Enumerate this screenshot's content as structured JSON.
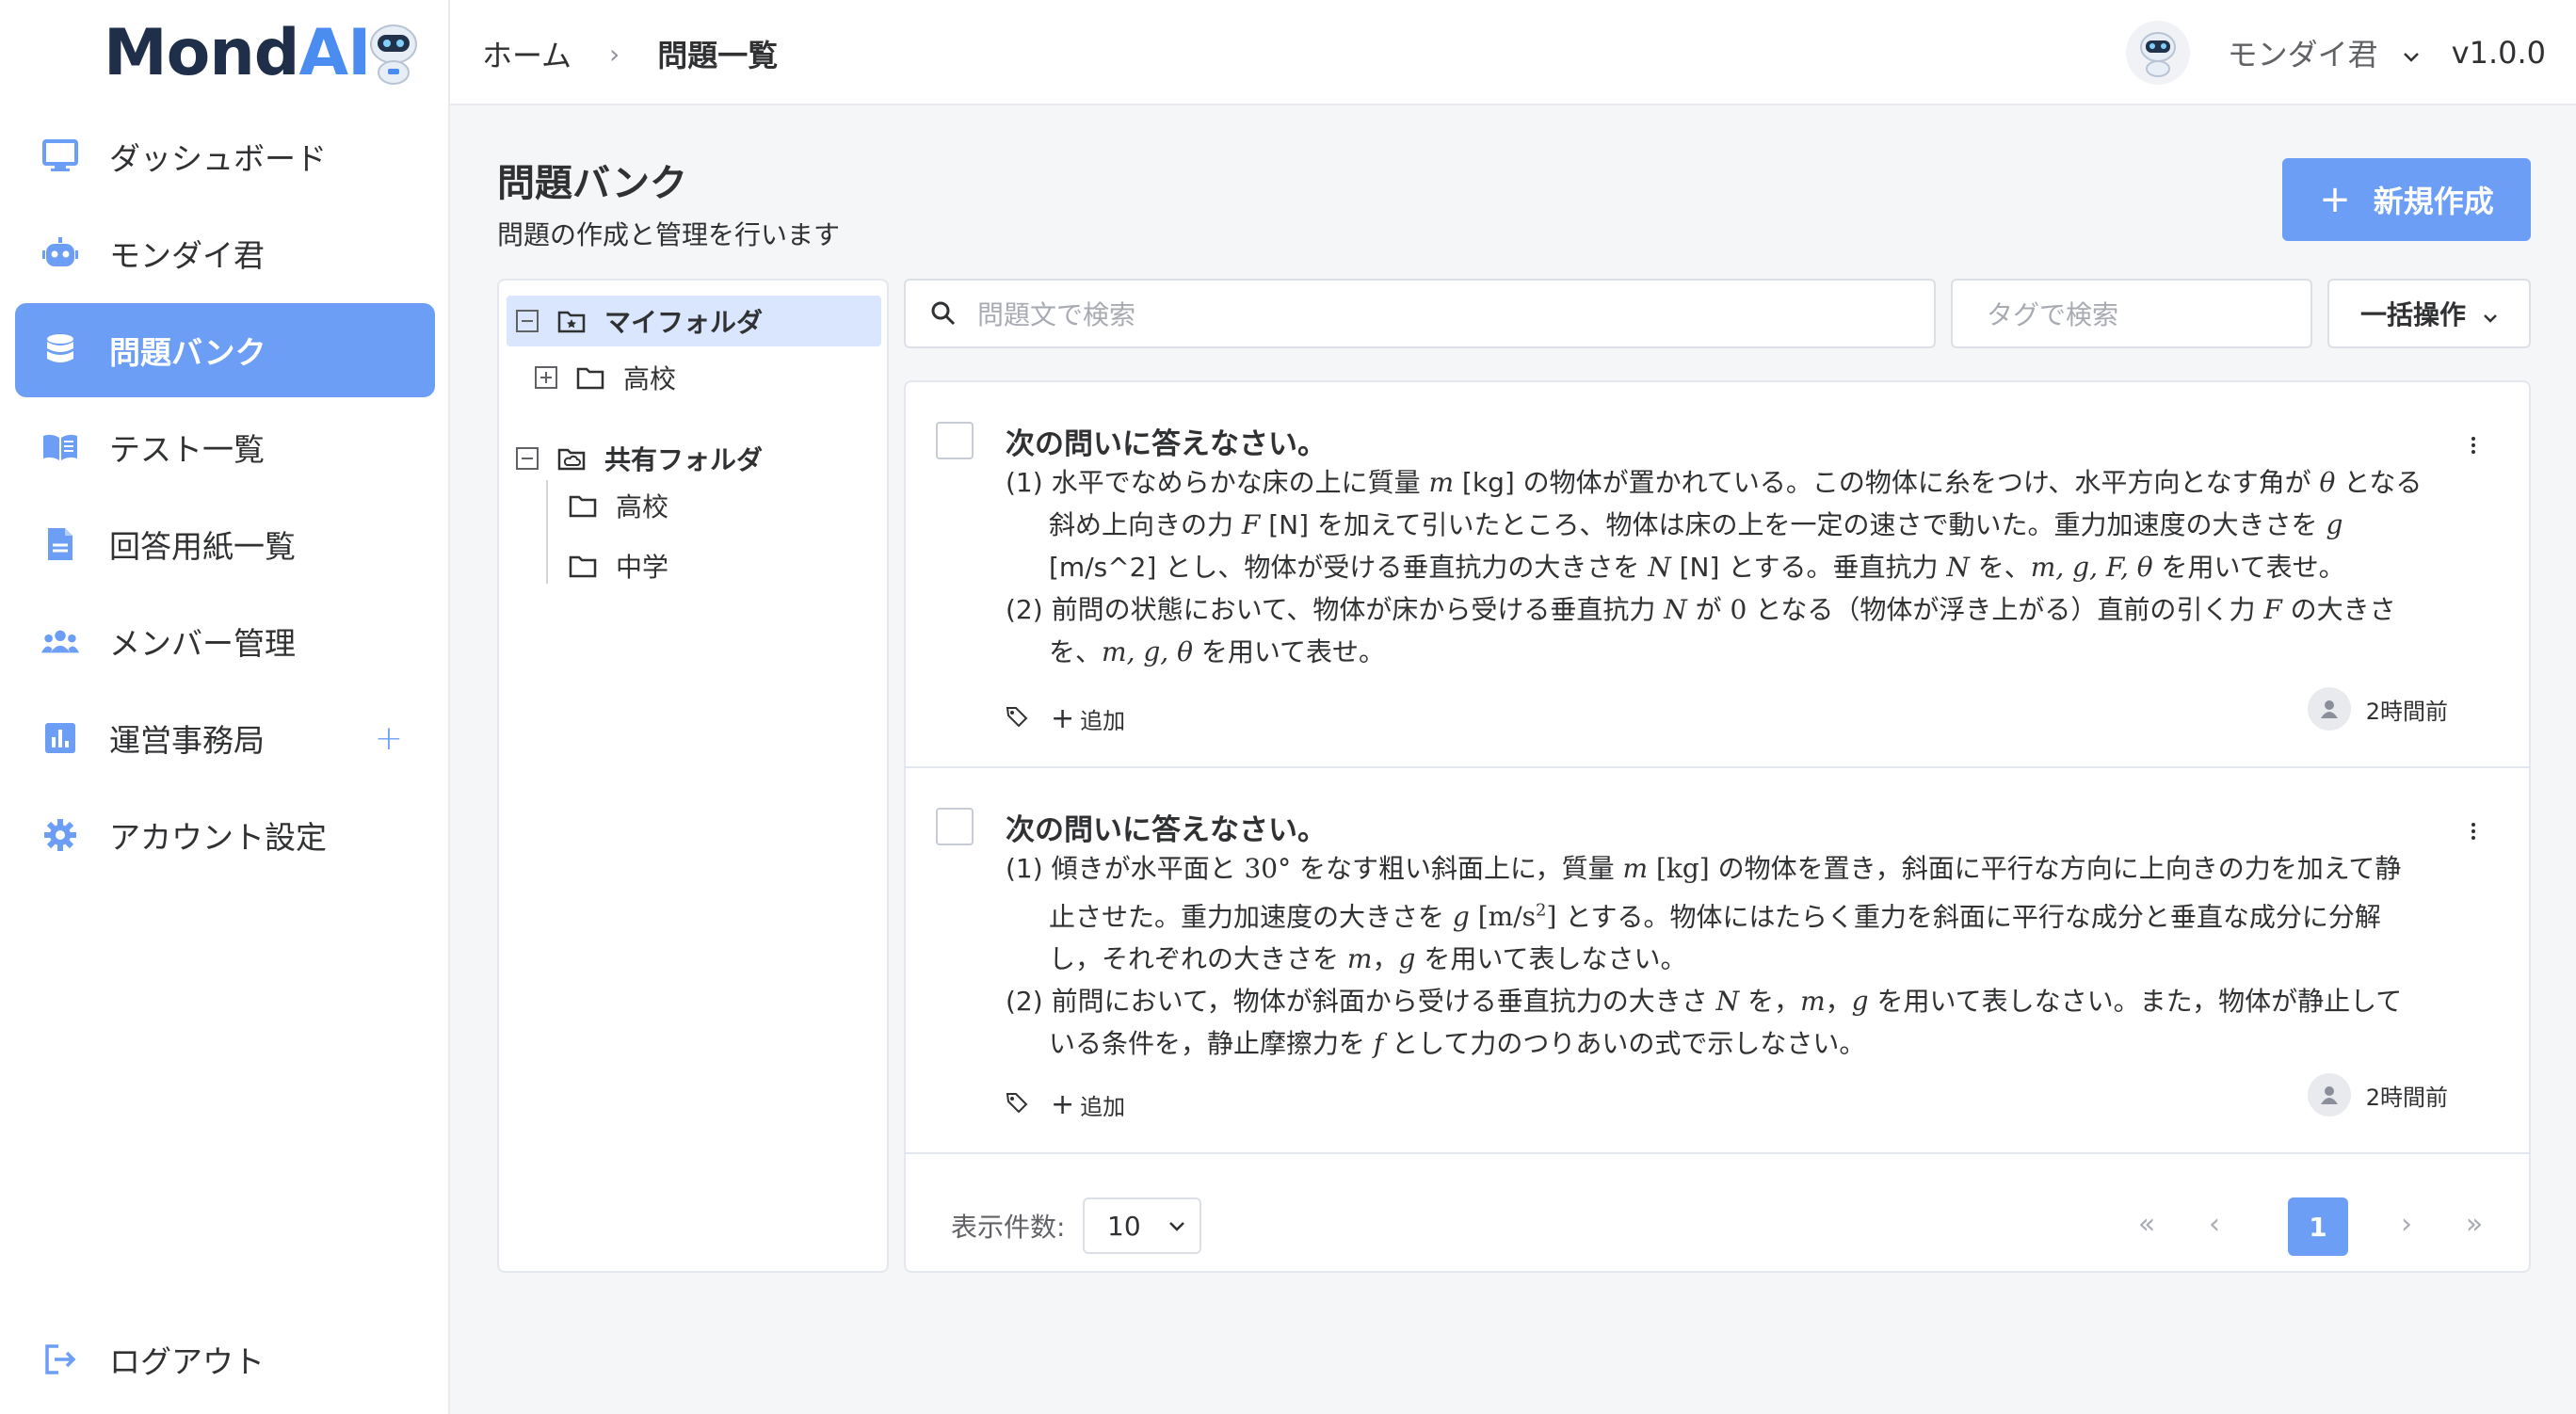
{
  "app": {
    "logo_main": "Mond",
    "logo_ai": "AI",
    "version": "v1.0.0"
  },
  "sidebar": {
    "items": [
      {
        "label": "ダッシュボード",
        "icon": "monitor-icon",
        "active": false
      },
      {
        "label": "モンダイ君",
        "icon": "robot-icon",
        "active": false
      },
      {
        "label": "問題バンク",
        "icon": "database-icon",
        "active": true
      },
      {
        "label": "テスト一覧",
        "icon": "book-icon",
        "active": false
      },
      {
        "label": "回答用紙一覧",
        "icon": "document-icon",
        "active": false
      },
      {
        "label": "メンバー管理",
        "icon": "users-icon",
        "active": false
      },
      {
        "label": "運営事務局",
        "icon": "chart-icon",
        "active": false,
        "expandable": true
      },
      {
        "label": "アカウント設定",
        "icon": "gear-icon",
        "active": false
      }
    ],
    "logout": "ログアウト"
  },
  "header": {
    "breadcrumb": [
      "ホーム",
      "問題一覧"
    ],
    "user_name": "モンダイ君"
  },
  "page": {
    "title": "問題バンク",
    "subtitle": "問題の作成と管理を行います",
    "new_button": "新規作成"
  },
  "folders": {
    "my_folder": "マイフォルダ",
    "my_children": [
      "高校"
    ],
    "shared_folder": "共有フォルダ",
    "shared_children": [
      "高校",
      "中学"
    ]
  },
  "filters": {
    "search_placeholder": "問題文で検索",
    "tag_placeholder": "タグで検索",
    "bulk_label": "一括操作"
  },
  "questions": [
    {
      "title": "次の問いに答えなさい。",
      "tag_add": "追加",
      "time": "2時間前"
    },
    {
      "title": "次の問いに答えなさい。",
      "tag_add": "追加",
      "time": "2時間前"
    }
  ],
  "pagination": {
    "page_size_label": "表示件数:",
    "page_size": "10",
    "current_page": "1"
  },
  "colors": {
    "accent": "#6c9ef5",
    "logo_dark": "#1f2f4a",
    "logo_ai": "#4a8cf0",
    "selected_folder_bg": "#d9e6fd"
  }
}
